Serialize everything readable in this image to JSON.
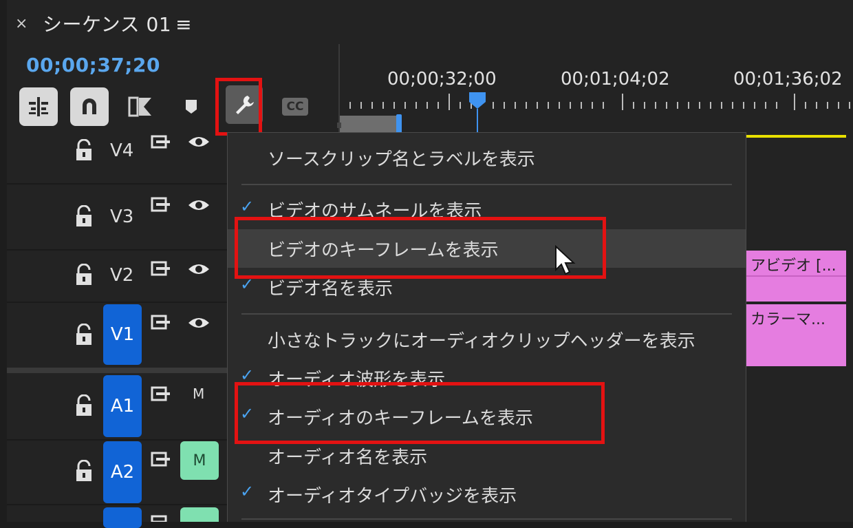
{
  "panel": {
    "close_glyph": "×",
    "title": "シーケンス 01",
    "menu_glyph": "≡",
    "timecode": "00;00;37;20"
  },
  "toolbar": {
    "buttons": [
      {
        "icon": "insert-nest-icon"
      },
      {
        "icon": "snap-magnet-icon"
      },
      {
        "icon": "linked-selection-icon"
      },
      {
        "icon": "add-marker-icon"
      },
      {
        "icon": "wrench-icon"
      },
      {
        "icon": "cc-icon",
        "label": "CC"
      }
    ]
  },
  "ruler": {
    "labels": [
      "00;00;32;00",
      "00;01;04;02",
      "00;01;36;02"
    ]
  },
  "tracks": [
    {
      "name": "V4",
      "targeted": false
    },
    {
      "name": "V3",
      "targeted": false
    },
    {
      "name": "V2",
      "targeted": false
    },
    {
      "name": "V1",
      "targeted": true
    },
    {
      "name": "A1",
      "targeted": true,
      "m_label": "M",
      "m_active": false
    },
    {
      "name": "A2",
      "targeted": true,
      "m_label": "M",
      "m_active": true
    }
  ],
  "clips": {
    "v2_label": "アビデオ [...",
    "v1_label": "カラーマ..."
  },
  "menu": {
    "items": [
      {
        "label": "ソースクリップ名とラベルを表示",
        "checked": false
      },
      {
        "label": "ビデオのサムネールを表示",
        "checked": true
      },
      {
        "label": "ビデオのキーフレームを表示",
        "checked": false,
        "hovered": true,
        "highlighted": true
      },
      {
        "label": "ビデオ名を表示",
        "checked": true
      },
      {
        "label": "小さなトラックにオーディオクリップヘッダーを表示",
        "checked": false
      },
      {
        "label": "オーディオ波形を表示",
        "checked": true
      },
      {
        "label": "オーディオのキーフレームを表示",
        "checked": true,
        "highlighted": true
      },
      {
        "label": "オーディオ名を表示",
        "checked": false
      },
      {
        "label": "オーディオタイプバッジを表示",
        "checked": true
      }
    ],
    "check_glyph": "✓"
  },
  "colors": {
    "accent_blue": "#1164d6",
    "timecode_blue": "#5aa7ee",
    "highlight_red": "#e31212",
    "clip_pink": "#e57de0",
    "mute_green": "#7fe0b0",
    "work_area_yellow": "#e8e000"
  }
}
